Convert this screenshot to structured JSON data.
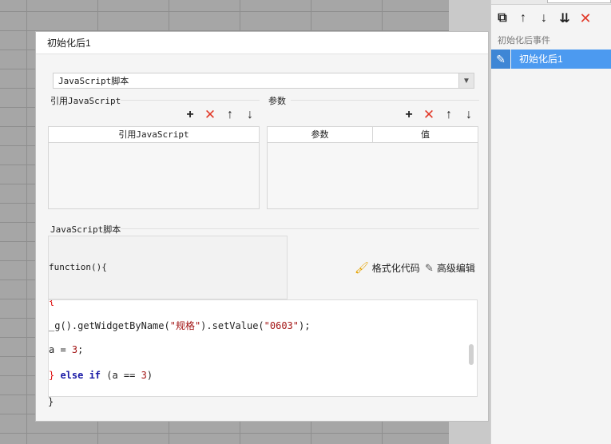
{
  "right_panel": {
    "toolbar": [
      "copy-icon",
      "arrow-up-icon",
      "arrow-down-icon",
      "move-bottom-icon",
      "delete-icon"
    ],
    "section_label": "初始化后事件",
    "selected_event": "初始化后1"
  },
  "dialog": {
    "title": "初始化后1",
    "type_select_value": "JavaScript脚本",
    "ref_group_label": "引用JavaScript",
    "params_group_label": "参数",
    "ref_table_header": "引用JavaScript",
    "params_table_headers": [
      "参数",
      "值"
    ],
    "script_group_label": "JavaScript脚本",
    "function_header": "function(){",
    "format_label": "格式化代码",
    "advanced_label": "高级编辑",
    "code_lines": {
      "line1": "{",
      "line2_a": "_g().getWidgetByName(",
      "line2_b": "\"规格\"",
      "line2_c": ").setValue(",
      "line2_d": "\"0603\"",
      "line2_e": ");",
      "line3_a": "a = ",
      "line3_b": "3",
      "line3_c": ";",
      "line4_a": "}",
      "line4_b": " else if",
      "line4_c": " (a == ",
      "line4_d": "3",
      "line4_e": ")"
    },
    "closing_brace": "}"
  },
  "colors": {
    "accent": "#4c9af0",
    "delete": "#e23a2a"
  }
}
